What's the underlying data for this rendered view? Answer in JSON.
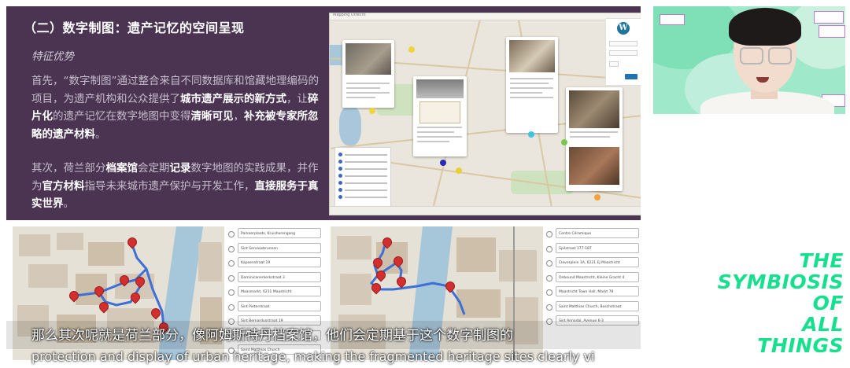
{
  "slide": {
    "heading": "（二）数字制图：遗产记忆的空间呈现",
    "subheading": "特征优势",
    "para1": [
      {
        "t": "首先，“数字制图”通过整合来自不同数据库和馆藏地理编码的项目，为遗产机构和公众提供了",
        "b": false
      },
      {
        "t": "城市遗产展示的新方式",
        "b": true
      },
      {
        "t": "，让",
        "b": false
      },
      {
        "t": "碎片化",
        "b": true
      },
      {
        "t": "的遗产记忆在数字地图中变得",
        "b": false
      },
      {
        "t": "清晰可见",
        "b": true
      },
      {
        "t": "，",
        "b": false
      },
      {
        "t": "补充被专家所忽略的遗产材料",
        "b": true
      },
      {
        "t": "。",
        "b": false
      }
    ],
    "para2": [
      {
        "t": "其次，荷兰部分",
        "b": false
      },
      {
        "t": "档案馆",
        "b": true
      },
      {
        "t": "会定期",
        "b": false
      },
      {
        "t": "记录",
        "b": true
      },
      {
        "t": "数字地图的实践成果，并作为",
        "b": false
      },
      {
        "t": "官方材料",
        "b": true
      },
      {
        "t": "指导未来城市遗产保护与开发工作，",
        "b": false
      },
      {
        "t": "直接服务于真实世界",
        "b": true
      },
      {
        "t": "。",
        "b": false
      }
    ]
  },
  "map_top": {
    "title": "Mapping Utrecht",
    "login_icon": "W"
  },
  "stops_left": [
    "Parkeerplaats, Kruisherengang",
    "Sint Servaasbrunnen",
    "Kapoenstraat 19",
    "Dominicanerkerkstraat 3",
    "Maasmarkt, 6211 Maastricht",
    "Sint Pieterstraat",
    "Sint Bernardusstraat 19",
    "Sint Servaasplein",
    "Saint Matthias Church"
  ],
  "stops_right": [
    "Centre Céramique",
    "Spilstraat 177-187",
    "Cleverplein 1A, 6221 EJ Maastricht",
    "Onbound Maastricht, Kleine Gracht 4",
    "Maastricht Town Hall, Markt 78",
    "Saint Matthias Church, Boschstraat",
    "Sint Annadal, Avenue 6-3"
  ],
  "brand": {
    "lines": [
      "THE",
      "SYMBIOSIS",
      "OF",
      "ALL",
      "THINGS"
    ],
    "color": "#16e08d"
  },
  "subtitle": {
    "zh": "那么其次呢就是荷兰部分，像阿姆斯特丹档案馆，他们会定期基于这个数字制图的",
    "en": "protection and display of urban heritage, making the fragmented heritage sites clearly vi"
  },
  "colors": {
    "slide_bg": "#4a3452",
    "route": "#3d6fd6",
    "pin": "#d32f2f"
  }
}
